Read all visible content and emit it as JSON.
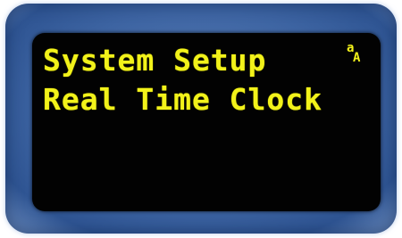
{
  "display": {
    "line1": "System Setup",
    "line2": "Real Time Clock",
    "mode_indicator_top": "a",
    "mode_indicator_bottom": "A"
  },
  "colors": {
    "text": "#f2f21a",
    "screen": "#020202",
    "bezel": "#3d64a2"
  }
}
